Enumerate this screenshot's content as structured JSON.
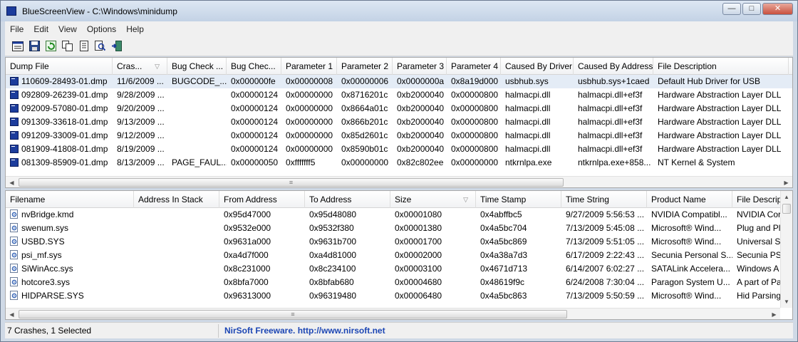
{
  "window": {
    "title": "BlueScreenView  -  C:\\Windows\\minidump",
    "app_icon": "bluescreen-app-icon",
    "buttons": {
      "minimize": "—",
      "maximize": "□",
      "close": "✕"
    }
  },
  "menu": [
    "File",
    "Edit",
    "View",
    "Options",
    "Help"
  ],
  "toolbar": [
    {
      "name": "properties-icon"
    },
    {
      "name": "save-icon"
    },
    {
      "name": "refresh-icon"
    },
    {
      "name": "copy-icon"
    },
    {
      "name": "report-icon"
    },
    {
      "name": "find-icon"
    },
    {
      "name": "exit-icon"
    }
  ],
  "crash_table": {
    "columns": [
      "Dump File",
      "Cras...",
      "Bug Check ...",
      "Bug Chec...",
      "Parameter 1",
      "Parameter 2",
      "Parameter 3",
      "Parameter 4",
      "Caused By Driver",
      "Caused By Address",
      "File Description"
    ],
    "sort_indicator": "▽",
    "rows": [
      [
        "110609-28493-01.dmp",
        "11/6/2009 ...",
        "BUGCODE_...",
        "0x000000fe",
        "0x00000008",
        "0x00000006",
        "0x0000000a",
        "0x8a19d000",
        "usbhub.sys",
        "usbhub.sys+1caed",
        "Default Hub Driver for USB"
      ],
      [
        "092809-26239-01.dmp",
        "9/28/2009 ...",
        "",
        "0x00000124",
        "0x00000000",
        "0x8716201c",
        "0xb2000040",
        "0x00000800",
        "halmacpi.dll",
        "halmacpi.dll+ef3f",
        "Hardware Abstraction Layer DLL"
      ],
      [
        "092009-57080-01.dmp",
        "9/20/2009 ...",
        "",
        "0x00000124",
        "0x00000000",
        "0x8664a01c",
        "0xb2000040",
        "0x00000800",
        "halmacpi.dll",
        "halmacpi.dll+ef3f",
        "Hardware Abstraction Layer DLL"
      ],
      [
        "091309-33618-01.dmp",
        "9/13/2009 ...",
        "",
        "0x00000124",
        "0x00000000",
        "0x866b201c",
        "0xb2000040",
        "0x00000800",
        "halmacpi.dll",
        "halmacpi.dll+ef3f",
        "Hardware Abstraction Layer DLL"
      ],
      [
        "091209-33009-01.dmp",
        "9/12/2009 ...",
        "",
        "0x00000124",
        "0x00000000",
        "0x85d2601c",
        "0xb2000040",
        "0x00000800",
        "halmacpi.dll",
        "halmacpi.dll+ef3f",
        "Hardware Abstraction Layer DLL"
      ],
      [
        "081909-41808-01.dmp",
        "8/19/2009 ...",
        "",
        "0x00000124",
        "0x00000000",
        "0x8590b01c",
        "0xb2000040",
        "0x00000800",
        "halmacpi.dll",
        "halmacpi.dll+ef3f",
        "Hardware Abstraction Layer DLL"
      ],
      [
        "081309-85909-01.dmp",
        "8/13/2009 ...",
        "PAGE_FAUL...",
        "0x00000050",
        "0xfffffff5",
        "0x00000000",
        "0x82c802ee",
        "0x00000000",
        "ntkrnlpa.exe",
        "ntkrnlpa.exe+858...",
        "NT Kernel & System"
      ]
    ],
    "selected_row": 0
  },
  "driver_table": {
    "columns": [
      "Filename",
      "Address In Stack",
      "From Address",
      "To Address",
      "Size",
      "Time Stamp",
      "Time String",
      "Product Name",
      "File Descrip"
    ],
    "sort_indicator": "▽",
    "rows": [
      [
        "nvBridge.kmd",
        "",
        "0x95d47000",
        "0x95d48080",
        "0x00001080",
        "0x4abffbc5",
        "9/27/2009 5:56:53 ...",
        "NVIDIA Compatibl...",
        "NVIDIA Cor"
      ],
      [
        "swenum.sys",
        "",
        "0x9532e000",
        "0x9532f380",
        "0x00001380",
        "0x4a5bc704",
        "7/13/2009 5:45:08 ...",
        "Microsoft® Wind...",
        "Plug and Pl"
      ],
      [
        "USBD.SYS",
        "",
        "0x9631a000",
        "0x9631b700",
        "0x00001700",
        "0x4a5bc869",
        "7/13/2009 5:51:05 ...",
        "Microsoft® Wind...",
        "Universal Se"
      ],
      [
        "psi_mf.sys",
        "",
        "0xa4d7f000",
        "0xa4d81000",
        "0x00002000",
        "0x4a38a7d3",
        "6/17/2009 2:22:43 ...",
        "Secunia Personal S...",
        "Secunia PSI"
      ],
      [
        "SiWinAcc.sys",
        "",
        "0x8c231000",
        "0x8c234100",
        "0x00003100",
        "0x4671d713",
        "6/14/2007 6:02:27 ...",
        "SATALink Accelera...",
        "Windows A"
      ],
      [
        "hotcore3.sys",
        "",
        "0x8bfa7000",
        "0x8bfab680",
        "0x00004680",
        "0x48619f9c",
        "6/24/2008 7:30:04 ...",
        "Paragon System U...",
        "A part of Pa"
      ],
      [
        "HIDPARSE.SYS",
        "",
        "0x96313000",
        "0x96319480",
        "0x00006480",
        "0x4a5bc863",
        "7/13/2009 5:50:59 ...",
        "Microsoft® Wind...",
        "Hid Parsing"
      ]
    ]
  },
  "status": {
    "count": "7 Crashes, 1 Selected",
    "link": "NirSoft Freeware.  http://www.nirsoft.net"
  },
  "colors": {
    "selection": "#e4ecf6",
    "dump_icon": "#1c3c9c",
    "link": "#1c46b4"
  }
}
